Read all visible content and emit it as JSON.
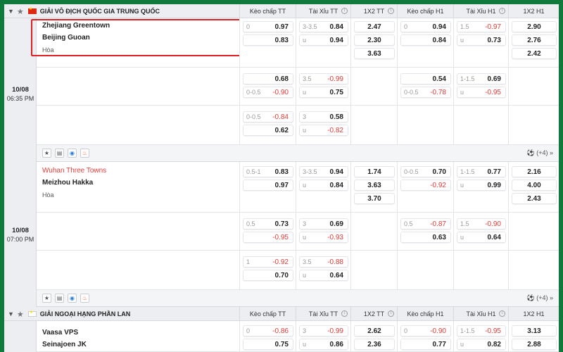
{
  "columns": [
    "Kèo chấp TT",
    "Tài Xỉu TT",
    "1X2 TT",
    "Kèo chấp H1",
    "Tài Xỉu H1",
    "1X2 H1"
  ],
  "leagues": [
    {
      "name": "GIẢI VÔ ĐỊCH QUỐC GIA TRUNG QUỐC",
      "matches": [
        {
          "date": "10/08",
          "time": "06:35 PM",
          "home": "Zhejiang Greentown",
          "away": "Beijing Guoan",
          "draw": "Hòa",
          "more": "(+4)",
          "rows": [
            {
              "hdp_tt": {
                "l1": "0",
                "v1": "0.97",
                "l2": "",
                "v2": "0.83"
              },
              "ou_tt": {
                "l1": "3-3.5",
                "v1": "0.84",
                "l2": "u",
                "v2": "0.94"
              },
              "x12_tt": [
                "2.47",
                "2.30",
                "3.63"
              ],
              "hdp_h1": {
                "l1": "0",
                "v1": "0.94",
                "l2": "",
                "v2": "0.84"
              },
              "ou_h1": {
                "l1": "1.5",
                "v1": "-0.97",
                "l2": "u",
                "v2": "0.73"
              },
              "x12_h1": [
                "2.90",
                "2.76",
                "2.42"
              ]
            },
            {
              "hdp_tt": {
                "l1": "",
                "v1": "0.68",
                "l2": "0-0.5",
                "v2": "-0.90"
              },
              "ou_tt": {
                "l1": "3.5",
                "v1": "-0.99",
                "l2": "u",
                "v2": "0.75"
              },
              "hdp_h1": {
                "l1": "",
                "v1": "0.54",
                "l2": "0-0.5",
                "v2": "-0.78"
              },
              "ou_h1": {
                "l1": "1-1.5",
                "v1": "0.69",
                "l2": "u",
                "v2": "-0.95"
              }
            },
            {
              "hdp_tt": {
                "l1": "0-0.5",
                "v1": "-0.84",
                "l2": "",
                "v2": "0.62"
              },
              "ou_tt": {
                "l1": "3",
                "v1": "0.58",
                "l2": "u",
                "v2": "-0.82"
              }
            }
          ]
        },
        {
          "date": "10/08",
          "time": "07:00 PM",
          "home": "Wuhan Three Towns",
          "away": "Meizhou Hakka",
          "draw": "Hòa",
          "more": "(+4)",
          "rows": [
            {
              "hdp_tt": {
                "l1": "0.5-1",
                "v1": "0.83",
                "l2": "",
                "v2": "0.97"
              },
              "ou_tt": {
                "l1": "3-3.5",
                "v1": "0.94",
                "l2": "u",
                "v2": "0.84"
              },
              "x12_tt": [
                "1.74",
                "3.63",
                "3.70"
              ],
              "hdp_h1": {
                "l1": "0-0.5",
                "v1": "0.70",
                "l2": "",
                "v2": "-0.92"
              },
              "ou_h1": {
                "l1": "1-1.5",
                "v1": "0.77",
                "l2": "u",
                "v2": "0.99"
              },
              "x12_h1": [
                "2.16",
                "4.00",
                "2.43"
              ]
            },
            {
              "hdp_tt": {
                "l1": "0.5",
                "v1": "0.73",
                "l2": "",
                "v2": "-0.95"
              },
              "ou_tt": {
                "l1": "3",
                "v1": "0.69",
                "l2": "u",
                "v2": "-0.93"
              },
              "hdp_h1": {
                "l1": "0.5",
                "v1": "-0.87",
                "l2": "",
                "v2": "0.63"
              },
              "ou_h1": {
                "l1": "1.5",
                "v1": "-0.90",
                "l2": "u",
                "v2": "0.64"
              }
            },
            {
              "hdp_tt": {
                "l1": "1",
                "v1": "-0.92",
                "l2": "",
                "v2": "0.70"
              },
              "ou_tt": {
                "l1": "3.5",
                "v1": "-0.88",
                "l2": "u",
                "v2": "0.64"
              }
            }
          ]
        }
      ]
    },
    {
      "name": "GIẢI NGOẠI HẠNG PHẦN LAN",
      "matches": [
        {
          "home": "Vaasa VPS",
          "away": "Seinajoen JK",
          "rows": [
            {
              "hdp_tt": {
                "l1": "0",
                "v1": "-0.86",
                "l2": "",
                "v2": "0.75"
              },
              "ou_tt": {
                "l1": "3",
                "v1": "-0.99",
                "l2": "u",
                "v2": "0.86"
              },
              "x12_tt": [
                "2.62",
                "2.36"
              ],
              "hdp_h1": {
                "l1": "0",
                "v1": "-0.90",
                "l2": "",
                "v2": "0.77"
              },
              "ou_h1": {
                "l1": "1-1.5",
                "v1": "-0.95",
                "l2": "u",
                "v2": "0.82"
              },
              "x12_h1": [
                "3.13",
                "2.88"
              ]
            }
          ]
        }
      ]
    }
  ],
  "colors": {
    "header_bg": "#0f7a3c",
    "negative": "#e23b36",
    "highlight": "#e02020"
  },
  "icons": [
    "chevron-down-icon",
    "star-icon",
    "china-flag-icon",
    "finland-flag-icon",
    "sort-icon",
    "favorite-icon",
    "stats-icon",
    "watch-icon",
    "hot-icon",
    "ball-icon",
    "double-chevron-right-icon"
  ]
}
